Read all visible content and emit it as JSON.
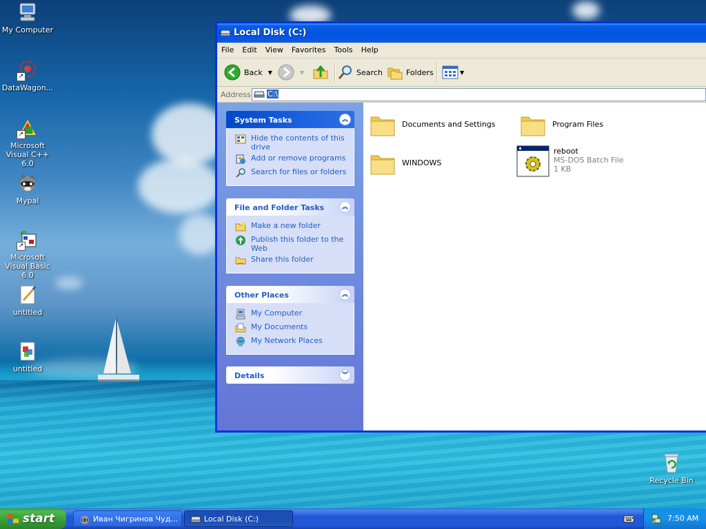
{
  "desktop": {
    "icons": [
      {
        "label": "My Computer"
      },
      {
        "label": "DataWagon..."
      },
      {
        "label": "Microsoft Visual C++ 6.0"
      },
      {
        "label": "Mypal"
      },
      {
        "label": "Microsoft Visual Basic 6.0"
      },
      {
        "label": "untitled"
      },
      {
        "label": "untitled"
      },
      {
        "label": "Recycle Bin"
      }
    ]
  },
  "window": {
    "title": "Local Disk (C:)",
    "menu": [
      "File",
      "Edit",
      "View",
      "Favorites",
      "Tools",
      "Help"
    ],
    "toolbar": {
      "back": "Back",
      "search": "Search",
      "folders": "Folders"
    },
    "address": {
      "label": "Address",
      "value": "C:\\"
    },
    "panels": [
      {
        "title": "System Tasks",
        "items": [
          "Hide the contents of this drive",
          "Add or remove programs",
          "Search for files or folders"
        ]
      },
      {
        "title": "File and Folder Tasks",
        "items": [
          "Make a new folder",
          "Publish this folder to the Web",
          "Share this folder"
        ]
      },
      {
        "title": "Other Places",
        "items": [
          "My Computer",
          "My Documents",
          "My Network Places"
        ]
      },
      {
        "title": "Details",
        "items": []
      }
    ],
    "files": [
      {
        "name": "Documents and Settings"
      },
      {
        "name": "Program Files"
      },
      {
        "name": "WINDOWS"
      },
      {
        "name": "reboot",
        "type": "MS-DOS Batch File",
        "size": "1 KB"
      }
    ]
  },
  "taskbar": {
    "start": "start",
    "buttons": [
      {
        "label": "Иван Чигринов Чуд..."
      },
      {
        "label": "Local Disk (C:)"
      }
    ],
    "clock": "7:50 AM"
  }
}
